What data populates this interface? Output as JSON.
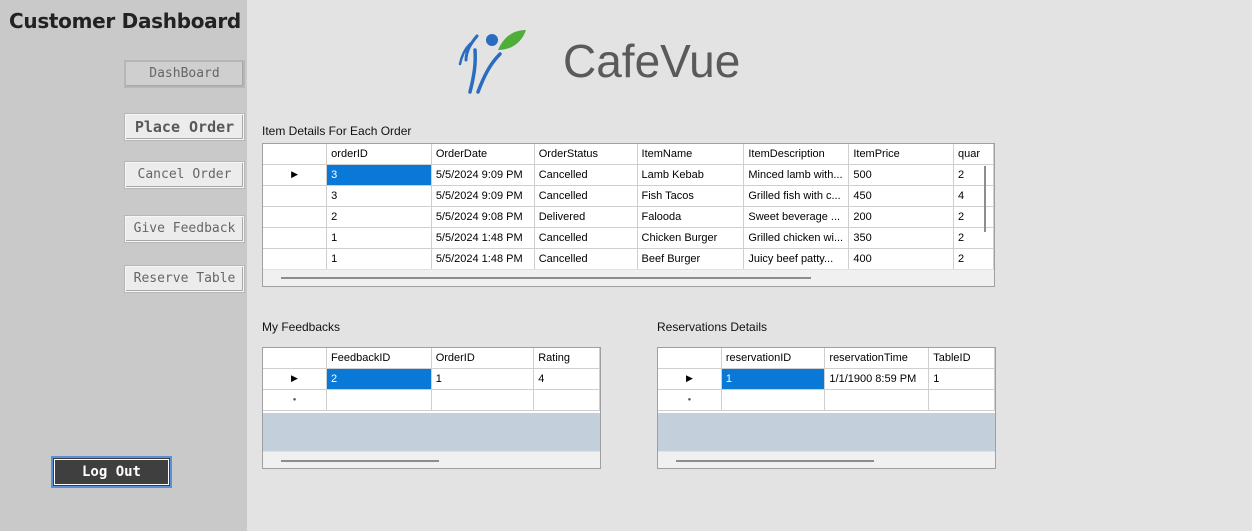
{
  "sidebar": {
    "title": "Customer Dashboard",
    "nav": [
      {
        "label": "DashBoard"
      },
      {
        "label": "Place Order"
      },
      {
        "label": "Cancel Order"
      },
      {
        "label": "Give Feedback"
      },
      {
        "label": "Reserve Table"
      }
    ],
    "logout_label": "Log Out"
  },
  "brand": {
    "name": "CafeVue"
  },
  "orders": {
    "label": "Item Details For Each Order",
    "columns": [
      "orderID",
      "OrderDate",
      "OrderStatus",
      "ItemName",
      "ItemDescription",
      "ItemPrice",
      "quar"
    ],
    "rows": [
      [
        "3",
        "5/5/2024 9:09 PM",
        "Cancelled",
        "Lamb Kebab",
        "Minced lamb with...",
        "500",
        "2"
      ],
      [
        "3",
        "5/5/2024 9:09 PM",
        "Cancelled",
        "Fish Tacos",
        "Grilled fish with c...",
        "450",
        "4"
      ],
      [
        "2",
        "5/5/2024 9:08 PM",
        "Delivered",
        "Falooda",
        "Sweet beverage ...",
        "200",
        "2"
      ],
      [
        "1",
        "5/5/2024 1:48 PM",
        "Cancelled",
        "Chicken Burger",
        "Grilled chicken wi...",
        "350",
        "2"
      ],
      [
        "1",
        "5/5/2024 1:48 PM",
        "Cancelled",
        "Beef Burger",
        "Juicy beef patty...",
        "400",
        "2"
      ]
    ]
  },
  "feedbacks": {
    "label": "My Feedbacks",
    "columns": [
      "FeedbackID",
      "OrderID",
      "Rating"
    ],
    "rows": [
      [
        "2",
        "1",
        "4"
      ]
    ]
  },
  "reservations": {
    "label": "Reservations Details",
    "columns": [
      "reservationID",
      "reservationTime",
      "TableID"
    ],
    "rows": [
      [
        "1",
        "1/1/1900 8:59 PM",
        "1"
      ]
    ]
  },
  "glyphs": {
    "current_row": "▶",
    "new_row": "●"
  },
  "colors": {
    "selection": "#0a78d7",
    "sidebar": "#c9c9c9",
    "background": "#e3e3e3",
    "logo_blue": "#2a6cc0",
    "logo_green": "#4fae3a"
  }
}
